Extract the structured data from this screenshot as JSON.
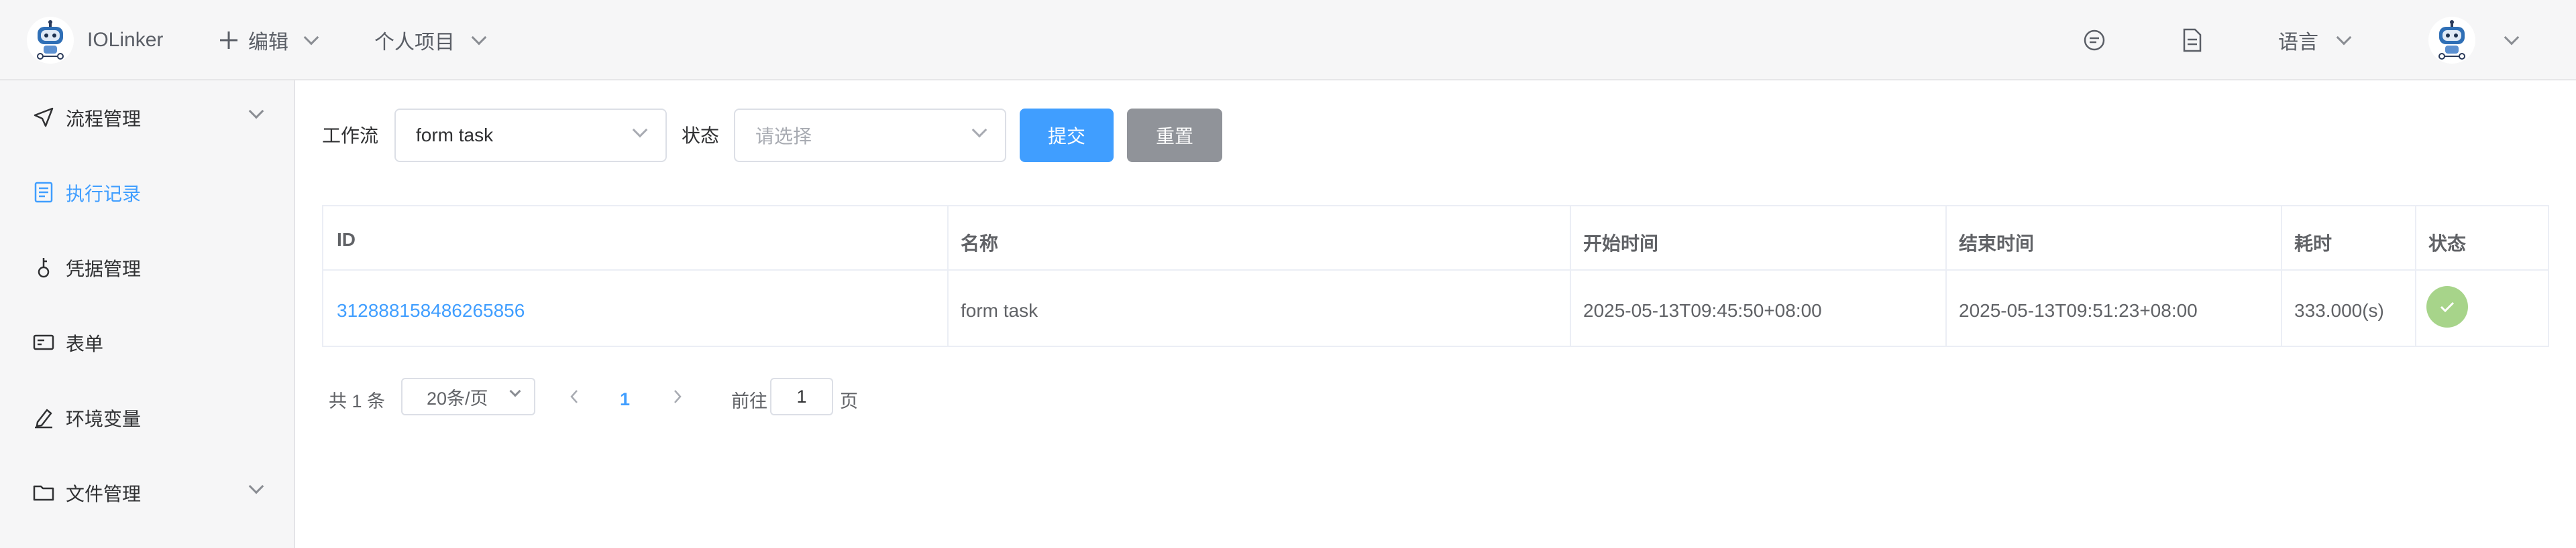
{
  "header": {
    "brand": "IOLinker",
    "edit_label": "编辑",
    "project_label": "个人项目",
    "language_label": "语言",
    "icons": [
      "robot-logo-icon",
      "plus-icon",
      "message-icon",
      "document-icon",
      "user-avatar-icon"
    ]
  },
  "sidebar": {
    "items": [
      {
        "label": "流程管理",
        "icon": "send-icon",
        "has_chevron": true
      },
      {
        "label": "执行记录",
        "icon": "document-icon",
        "active": true
      },
      {
        "label": "凭据管理",
        "icon": "key-icon"
      },
      {
        "label": "表单",
        "icon": "form-icon"
      },
      {
        "label": "环境变量",
        "icon": "edit-icon"
      },
      {
        "label": "文件管理",
        "icon": "folder-icon",
        "has_chevron": true
      }
    ]
  },
  "filter": {
    "workflow_label": "工作流",
    "workflow_value": "form task",
    "status_label": "状态",
    "status_placeholder": "请选择",
    "submit_label": "提交",
    "reset_label": "重置"
  },
  "table": {
    "columns": [
      "ID",
      "名称",
      "开始时间",
      "结束时间",
      "耗时",
      "状态"
    ],
    "rows": [
      {
        "id": "312888158486265856",
        "name": "form task",
        "start": "2025-05-13T09:45:50+08:00",
        "end": "2025-05-13T09:51:23+08:00",
        "duration": "333.000(s)",
        "status": "success"
      }
    ]
  },
  "pagination": {
    "total_text": "共 1 条",
    "page_size": "20条/页",
    "current_page": "1",
    "goto_prefix": "前往",
    "goto_value": "1",
    "goto_suffix": "页"
  },
  "colors": {
    "accent": "#409eff",
    "reset_button": "#909399",
    "success": "#a7d48a",
    "sidebar_bg": "#f6f6f7"
  }
}
